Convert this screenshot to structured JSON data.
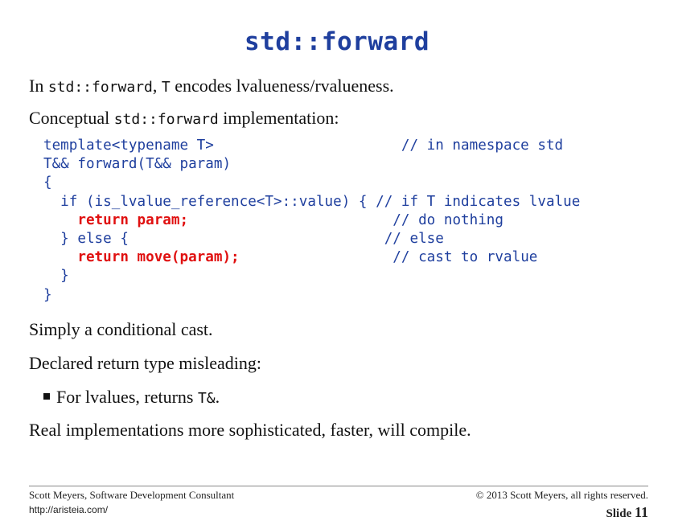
{
  "title": "std::forward",
  "intro": {
    "prefix": "In ",
    "code1": "std::forward",
    "middle": ", ",
    "code2": "T",
    "suffix": " encodes lvalueness/rvalueness."
  },
  "conceptual": {
    "prefix": "Conceptual ",
    "code": "std::forward",
    "suffix": " implementation:"
  },
  "code_lines": [
    {
      "text": "template<typename T>                      // in namespace std",
      "highlight": ""
    },
    {
      "text": "T&& forward(T&& param)",
      "highlight": ""
    },
    {
      "text": "{",
      "highlight": ""
    },
    {
      "text": "  if (is_lvalue_reference<T>::value) { // if T indicates lvalue",
      "highlight": ""
    },
    {
      "pre": "    ",
      "highlight": "return param;",
      "post": "                        // do nothing"
    },
    {
      "text": "  } else {                              // else",
      "highlight": ""
    },
    {
      "pre": "    ",
      "highlight": "return move(param);",
      "post": "                  // cast to rvalue"
    },
    {
      "text": "  }",
      "highlight": ""
    },
    {
      "text": "}",
      "highlight": ""
    }
  ],
  "simply": "Simply a conditional cast.",
  "declared": "Declared return type misleading:",
  "bullet": {
    "prefix": "For lvalues, returns ",
    "code": "T&",
    "suffix": "."
  },
  "real": "Real implementations more sophisticated, faster, will compile.",
  "footer": {
    "author": "Scott Meyers, Software Development Consultant",
    "url": "http://aristeia.com/",
    "copyright": "© 2013 Scott Meyers, all rights reserved.",
    "slide_label": "Slide",
    "slide_number": "11"
  }
}
